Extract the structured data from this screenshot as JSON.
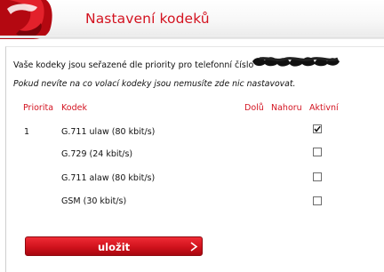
{
  "header": {
    "title": "Nastavení kodeků",
    "logo_icon": "red-telephone-handset-logo"
  },
  "info_text": "Vaše kodeky jsou seřazené dle priority pro telefonní číslo",
  "note_text": "Pokud nevíte na co volací kodeky jsou nemusíte zde nic nastavovat.",
  "table": {
    "headers": {
      "priority": "Priorita",
      "codec": "Kodek",
      "down": "Dolů",
      "up": "Nahoru",
      "active": "Aktivní"
    },
    "rows": [
      {
        "priority": "1",
        "codec": "G.711 ulaw (80 kbit/s)",
        "active": true
      },
      {
        "priority": "",
        "codec": "G.729 (24 kbit/s)",
        "active": false
      },
      {
        "priority": "",
        "codec": "G.711 alaw (80 kbit/s)",
        "active": false
      },
      {
        "priority": "",
        "codec": "GSM (30 kbit/s)",
        "active": false
      }
    ]
  },
  "save_button": {
    "label": "uložit",
    "icon": "arrow-right-icon"
  },
  "colors": {
    "accent": "#d31320",
    "button": "#d0121c"
  }
}
